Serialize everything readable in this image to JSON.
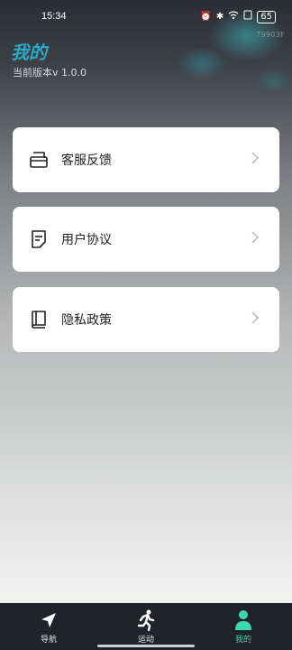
{
  "status_bar": {
    "time": "15:34",
    "battery": "65",
    "icons": [
      "alarm-icon",
      "bluetooth-icon",
      "wifi-icon",
      "sim-icon",
      "battery-icon"
    ]
  },
  "corner_code": "79903F",
  "header": {
    "title": "我的",
    "version": "当前版本v 1.0.0"
  },
  "menu": [
    {
      "label": "客服反馈",
      "icon": "message-box-icon"
    },
    {
      "label": "用户协议",
      "icon": "document-icon"
    },
    {
      "label": "隐私政策",
      "icon": "book-icon"
    }
  ],
  "bottom_nav": [
    {
      "label": "导航",
      "icon": "navigation-arrow-icon",
      "active": false
    },
    {
      "label": "运动",
      "icon": "running-person-icon",
      "active": false
    },
    {
      "label": "我的",
      "icon": "user-icon",
      "active": true
    }
  ],
  "colors": {
    "accent": "#3ed6b0",
    "title": "#2aa9c9",
    "nav_bg": "#202329"
  }
}
